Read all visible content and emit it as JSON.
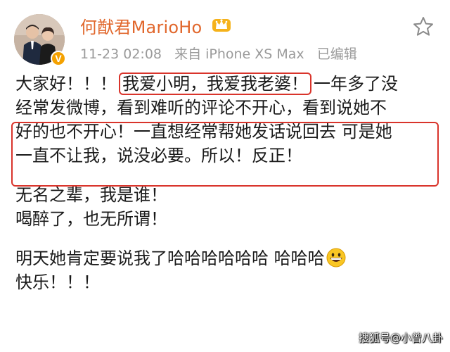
{
  "header": {
    "username": "何猷君MarioHo",
    "timestamp": "11-23 02:08",
    "source": "来自 iPhone XS Max",
    "edited": "已编辑",
    "verified_badge": "V",
    "icons": [
      "avatar-photo",
      "verified-icon",
      "crown-icon",
      "star-icon"
    ]
  },
  "post": {
    "line1_prefix": "大家好！！！",
    "line1_highlight": "我爱小明，我爱我老婆！",
    "line1_suffix": "一年多了没",
    "line2": "经常发微博，看到难听的评论不开心，看到说她不",
    "line3": "好的也不开心！一直想经常帮她发话说回去 可是她",
    "line4": "一直不让我，说没必要。所以！反正！",
    "line5": "无名之辈，我是谁！",
    "line6": "喝醉了，也无所谓！",
    "line7": "明天她肯定要说我了哈哈哈哈哈哈 哈哈哈",
    "line8": "快乐！！！",
    "emoji": "grinning-face-icon"
  },
  "watermark": "搜狐号@小曾八卦",
  "colors": {
    "username": "#e1672c",
    "meta": "#9a9a9a",
    "highlight_border": "#d9342b",
    "verified": "#f4a100"
  }
}
